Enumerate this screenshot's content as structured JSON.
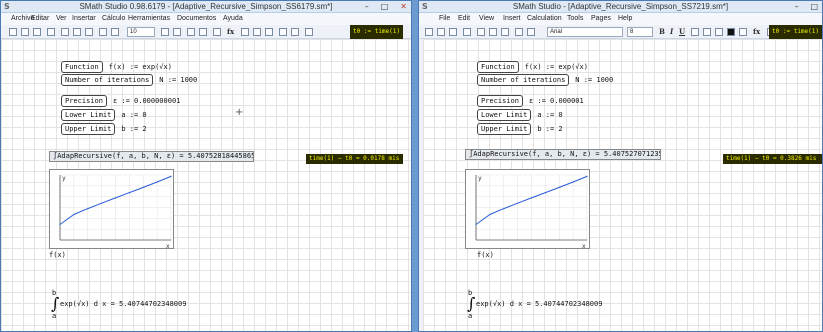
{
  "left": {
    "title": "SMath Studio 0.98.6179 - [Adaptive_Recursive_Simpson_SS6179.sm*]",
    "menu": [
      "Archivo",
      "Editar",
      "Ver",
      "Insertar",
      "Cálculo",
      "Herramientas",
      "Documentos",
      "Ayuda"
    ],
    "toolbar": {
      "font_size": "10",
      "t0_label": "t0 := time(1)"
    },
    "sheet": {
      "function_label": "Function",
      "function_expr": "f(x) := exp(√x)",
      "iterations_label": "Number of iterations",
      "iterations_expr": "N := 1000",
      "precision_label": "Precision",
      "precision_expr": "ε := 0.000000001",
      "lower_label": "Lower Limit",
      "lower_expr": "a := 0",
      "upper_label": "Upper Limit",
      "upper_expr": "b := 2",
      "adap_result": "∫AdapRecursive(f, a, b, N, ε) = 5.40752818445865",
      "time_result": "time(1) − t0 = 0.0178 mis",
      "plot_caption": "f(x)",
      "integral": {
        "upper": "b",
        "lower": "a",
        "body": "exp(√x) d x = 5.40744702348009"
      }
    }
  },
  "right": {
    "title": "SMath Studio - [Adaptive_Recursive_Simpson_SS7219.sm*]",
    "menu": [
      "File",
      "Edit",
      "View",
      "Insert",
      "Calculation",
      "Tools",
      "Pages",
      "Help"
    ],
    "toolbar": {
      "font_name": "Arial",
      "font_size": "8",
      "t0_label": "t0 := time(1)"
    },
    "sheet": {
      "function_label": "Function",
      "function_expr": "f(x) := exp(√x)",
      "iterations_label": "Number of iterations",
      "iterations_expr": "N := 1000",
      "precision_label": "Precision",
      "precision_expr": "ε := 0.000001",
      "lower_label": "Lower Limit",
      "lower_expr": "a := 0",
      "upper_label": "Upper Limit",
      "upper_expr": "b := 2",
      "adap_result": "∫AdapRecursive(f, a, b, N, ε) = 5.40752707123524",
      "time_result": "time(1) − t0 = 0.3826 mis",
      "plot_caption": "f(x)",
      "integral": {
        "upper": "b",
        "lower": "a",
        "body": "exp(√x) d x = 5.40744702348009"
      }
    }
  },
  "chart_data": [
    {
      "type": "line",
      "x": [
        0,
        0.25,
        0.5,
        0.75,
        1,
        1.25,
        1.5,
        1.75,
        2
      ],
      "y": [
        1,
        1.65,
        2.03,
        2.38,
        2.72,
        3.06,
        3.4,
        3.75,
        4.11
      ],
      "xlabel": "x",
      "ylabel": "y"
    },
    {
      "type": "line",
      "x": [
        0,
        0.25,
        0.5,
        0.75,
        1,
        1.25,
        1.5,
        1.75,
        2
      ],
      "y": [
        1,
        1.65,
        2.03,
        2.38,
        2.72,
        3.06,
        3.4,
        3.75,
        4.11
      ],
      "xlabel": "x",
      "ylabel": "y"
    }
  ],
  "colors": {
    "curve": "#2a5bd7",
    "time_bg": "#2b2b00",
    "time_fg": "#f2f200"
  }
}
